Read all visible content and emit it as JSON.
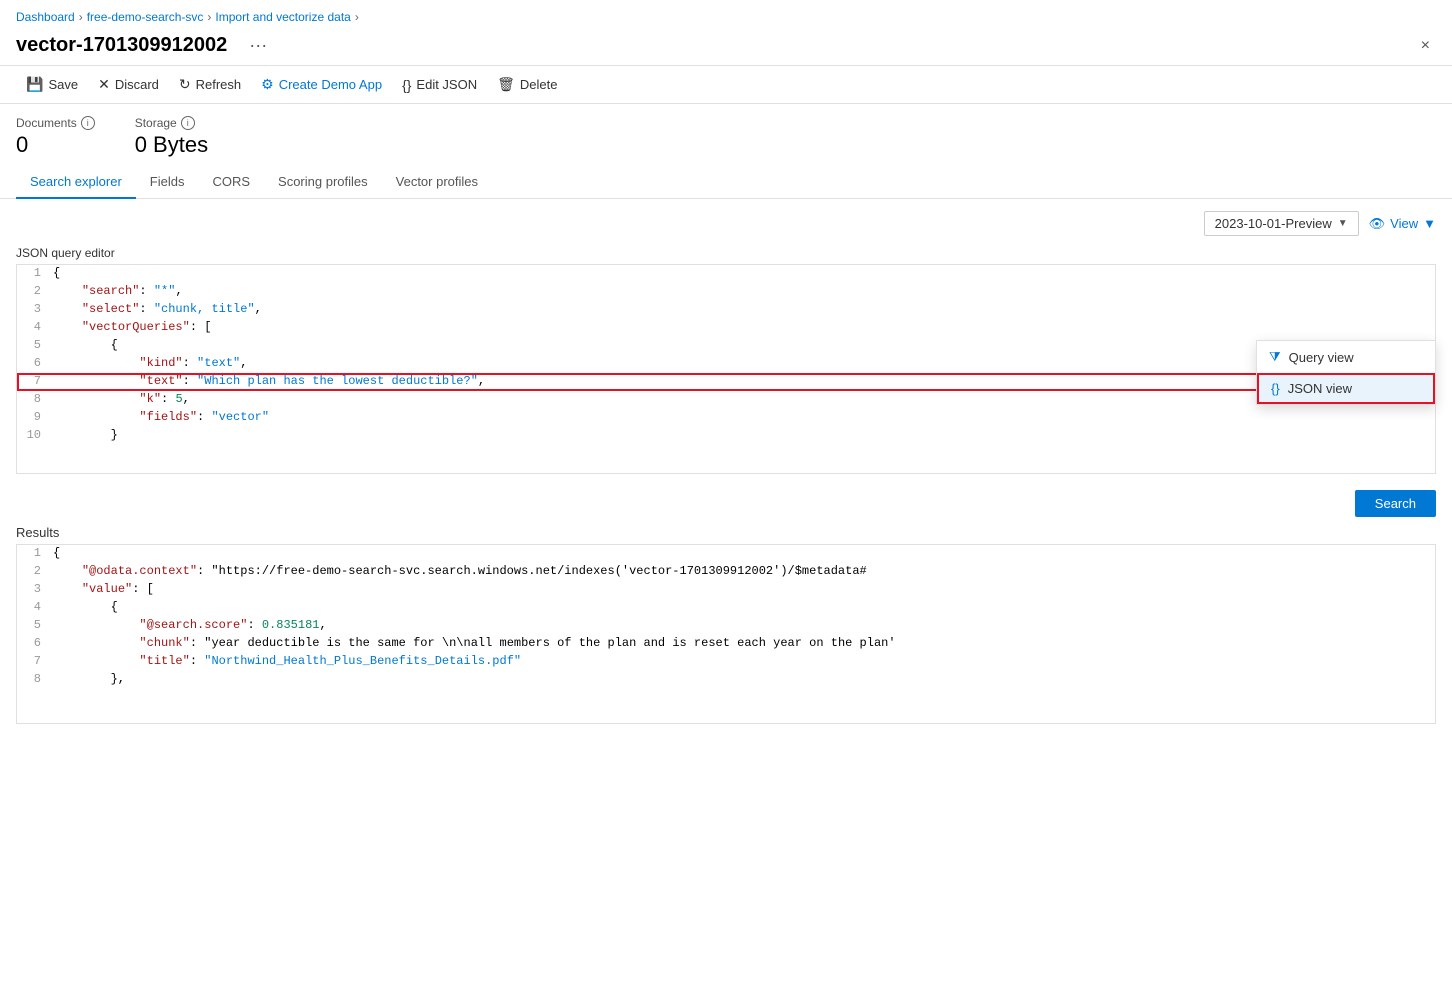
{
  "breadcrumb": {
    "items": [
      "Dashboard",
      "free-demo-search-svc",
      "Import and vectorize data"
    ]
  },
  "header": {
    "title": "vector-1701309912002",
    "menu_label": "···",
    "close_label": "×"
  },
  "toolbar": {
    "save_label": "Save",
    "discard_label": "Discard",
    "refresh_label": "Refresh",
    "create_demo_label": "Create Demo App",
    "edit_json_label": "Edit JSON",
    "delete_label": "Delete"
  },
  "stats": {
    "documents_label": "Documents",
    "documents_value": "0",
    "storage_label": "Storage",
    "storage_value": "0 Bytes"
  },
  "tabs": [
    {
      "id": "search-explorer",
      "label": "Search explorer",
      "active": true
    },
    {
      "id": "fields",
      "label": "Fields",
      "active": false
    },
    {
      "id": "cors",
      "label": "CORS",
      "active": false
    },
    {
      "id": "scoring-profiles",
      "label": "Scoring profiles",
      "active": false
    },
    {
      "id": "vector-profiles",
      "label": "Vector profiles",
      "active": false
    }
  ],
  "version_dropdown": {
    "value": "2023-10-01-Preview",
    "label": "2023-10-01-Preview"
  },
  "view_menu": {
    "label": "View",
    "items": [
      {
        "id": "query-view",
        "label": "Query view",
        "icon": "funnel"
      },
      {
        "id": "json-view",
        "label": "JSON view",
        "icon": "braces",
        "selected": true
      }
    ]
  },
  "editor": {
    "label": "JSON query editor",
    "lines": [
      {
        "num": 1,
        "content": "{",
        "highlight": false
      },
      {
        "num": 2,
        "content": "    \"search\": \"*\",",
        "highlight": false
      },
      {
        "num": 3,
        "content": "    \"select\": \"chunk, title\",",
        "highlight": false
      },
      {
        "num": 4,
        "content": "    \"vectorQueries\": [",
        "highlight": false
      },
      {
        "num": 5,
        "content": "        {",
        "highlight": false
      },
      {
        "num": 6,
        "content": "            \"kind\": \"text\",",
        "highlight": false
      },
      {
        "num": 7,
        "content": "            \"text\": \"Which plan has the lowest deductible?\",",
        "highlight": true
      },
      {
        "num": 8,
        "content": "            \"k\": 5,",
        "highlight": false
      },
      {
        "num": 9,
        "content": "            \"fields\": \"vector\"",
        "highlight": false
      },
      {
        "num": 10,
        "content": "        }",
        "highlight": false
      }
    ]
  },
  "search_button": {
    "label": "Search"
  },
  "results": {
    "label": "Results",
    "lines": [
      {
        "num": 1,
        "content": "{"
      },
      {
        "num": 2,
        "content": "    \"@odata.context\": \"https://free-demo-search-svc.search.windows.net/indexes('vector-1701309912002')/$metadata#"
      },
      {
        "num": 3,
        "content": "    \"value\": ["
      },
      {
        "num": 4,
        "content": "        {"
      },
      {
        "num": 5,
        "content": "            \"@search.score\": 0.835181,"
      },
      {
        "num": 6,
        "content": "            \"chunk\": \"year deductible is the same for \\n\\nall members of the plan and is reset each year on the plan'"
      },
      {
        "num": 7,
        "content": "            \"title\": \"Northwind_Health_Plus_Benefits_Details.pdf\""
      },
      {
        "num": 8,
        "content": "        },"
      }
    ]
  }
}
